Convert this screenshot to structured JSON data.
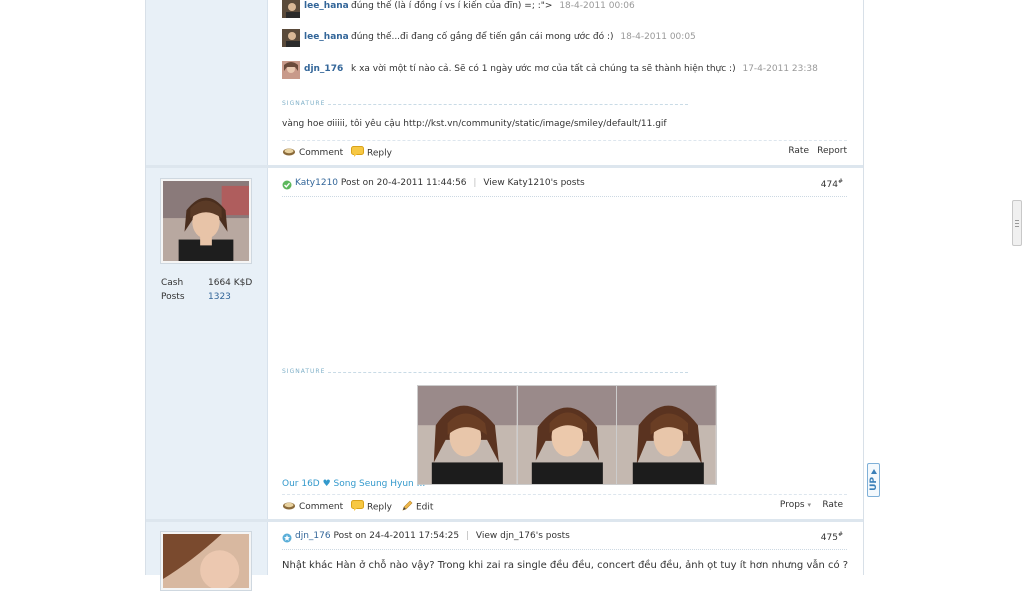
{
  "post_top": {
    "comments": [
      {
        "user": "lee_hana",
        "text": "đúng thế (là í đồng í vs í kiến của đĩn) =; :\">",
        "time": "18-4-2011 00:06"
      },
      {
        "user": "lee_hana",
        "text": "đúng thế...đi đang cố gắng để tiến gần cái mong ước đó :)",
        "time": "18-4-2011 00:05"
      },
      {
        "user": "djn_176",
        "text": "k xa vời một tí nào cả. Sẽ có 1 ngày ước mơ của tất cả chúng ta sẽ thành hiện thực :)",
        "time": "17-4-2011 23:38"
      }
    ],
    "signature_label": "SIGNATURE",
    "signature_text": "vàng hoe ơiiiii, tôi yêu cậu http://kst.vn/community/static/image/smiley/default/11.gif",
    "actions": {
      "comment": "Comment",
      "reply": "Reply",
      "rate": "Rate",
      "report": "Report"
    }
  },
  "post_474": {
    "author": "Katy1210",
    "post_meta": "Post on 20-4-2011 11:44:56",
    "view_posts": "View Katy1210's posts",
    "number": "474",
    "number_sup": "#",
    "stats": [
      {
        "label": "Cash",
        "value": "1664 K$D"
      },
      {
        "label": "Posts",
        "value": "1323"
      }
    ],
    "signature_label": "SIGNATURE",
    "signature_link": "Our 16D ♥ Song Seung Hyun ...",
    "actions": {
      "comment": "Comment",
      "reply": "Reply",
      "edit": "Edit",
      "props": "Props",
      "rate": "Rate"
    }
  },
  "post_475": {
    "author": "djn_176",
    "post_meta": "Post on 24-4-2011 17:54:25",
    "view_posts": "View djn_176's posts",
    "number": "475",
    "number_sup": "#",
    "body": "Nhật khác Hàn ở chỗ nào vậy? Trong khi zai ra single đều đều, concert đều đều, ảnh ọt tuy ít hơn nhưng vẫn có ?"
  },
  "up_button": {
    "label": "UP"
  },
  "colors": {
    "link": "#336699",
    "sidebar_bg": "#e8f0f7",
    "signature_link": "#3399cc",
    "muted": "#999999"
  }
}
